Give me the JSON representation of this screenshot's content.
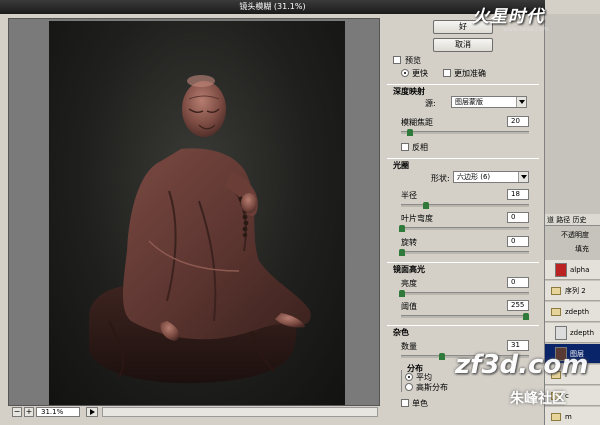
{
  "window": {
    "title": "镜头模糊 (31.1%)"
  },
  "buttons": {
    "ok": "好",
    "cancel": "取消"
  },
  "preview": {
    "preview_label": "预览",
    "faster_label": "更快",
    "accurate_label": "更加准确"
  },
  "depth_map": {
    "section": "深度映射",
    "source_label": "源:",
    "source_value": "图层蒙版",
    "blur_focal_label": "模糊焦距",
    "blur_focal_value": "20",
    "blur_focal_fraction": 0.05,
    "invert_label": "反相"
  },
  "iris": {
    "section": "光圈",
    "shape_label": "形状:",
    "shape_value": "六边形 (6)",
    "radius_label": "半径",
    "radius_value": "18",
    "radius_fraction": 0.18,
    "curvature_label": "叶片弯度",
    "curvature_value": "0",
    "rotation_label": "旋转",
    "rotation_value": "0"
  },
  "specular": {
    "section": "镜面高光",
    "brightness_label": "亮度",
    "brightness_value": "0",
    "threshold_label": "阈值",
    "threshold_value": "255",
    "threshold_fraction": 1.0
  },
  "noise": {
    "section": "杂色",
    "amount_label": "数量",
    "amount_value": "31",
    "amount_fraction": 0.31,
    "distribution_label": "分布",
    "uniform_label": "平均",
    "gaussian_label": "高斯分布",
    "mono_label": "单色"
  },
  "zoom": {
    "minus": "−",
    "plus": "+",
    "value": "31.1%"
  },
  "layers_panel": {
    "tabs": "道 路径 历史",
    "opacity_label": "不透明度",
    "fill_label": "填充",
    "items": [
      {
        "name": "alpha"
      },
      {
        "name": "序列 2"
      },
      {
        "name": "zdepth"
      },
      {
        "name": "zdepth"
      },
      {
        "name": "图层"
      },
      {
        "name": "l"
      },
      {
        "name": "c"
      },
      {
        "name": "m"
      }
    ]
  },
  "branding": {
    "logo": "火星时代",
    "logo_sub": "www.hxsd.com",
    "watermark": "zf3d.com",
    "watermark_sub": "朱峰社区"
  },
  "colors": {
    "accent": "#2f7a3a",
    "titlebar": "#1b1b1b",
    "dialog_bg": "#d4d0c8"
  }
}
